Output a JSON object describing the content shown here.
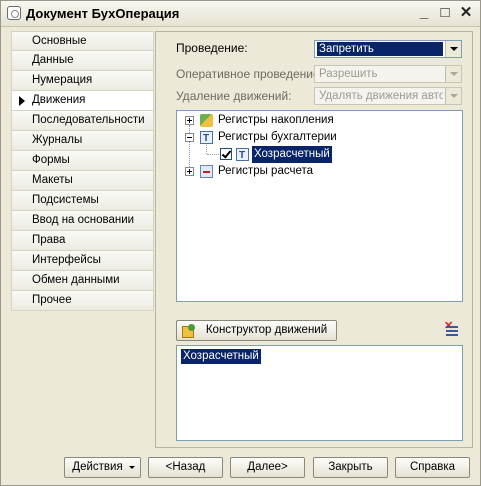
{
  "window": {
    "title": "Документ БухОперация",
    "controls": {
      "minimize": "_",
      "maximize": "□",
      "close": "✕"
    }
  },
  "nav": {
    "items": [
      {
        "label": "Основные",
        "active": false
      },
      {
        "label": "Данные",
        "active": false
      },
      {
        "label": "Нумерация",
        "active": false
      },
      {
        "label": "Движения",
        "active": true
      },
      {
        "label": "Последовательности",
        "active": false
      },
      {
        "label": "Журналы",
        "active": false
      },
      {
        "label": "Формы",
        "active": false
      },
      {
        "label": "Макеты",
        "active": false
      },
      {
        "label": "Подсистемы",
        "active": false
      },
      {
        "label": "Ввод на основании",
        "active": false
      },
      {
        "label": "Права",
        "active": false
      },
      {
        "label": "Интерфейсы",
        "active": false
      },
      {
        "label": "Обмен данными",
        "active": false
      },
      {
        "label": "Прочее",
        "active": false
      }
    ]
  },
  "properties": {
    "posting": {
      "label": "Проведение:",
      "value": "Запретить"
    },
    "realtime_posting": {
      "label": "Оперативное проведение:",
      "value": "Разрешить"
    },
    "delete_movements": {
      "label": "Удаление движений:",
      "value": "Удалять движения автом"
    }
  },
  "tree": {
    "nodes": [
      {
        "label": "Регистры накопления",
        "icon": "accumulation-register-icon"
      },
      {
        "label": "Регистры бухгалтерии",
        "icon": "accounting-register-icon"
      },
      {
        "label": "Хозрасчетный",
        "icon": "accounting-register-icon",
        "checked": true,
        "selected": true
      },
      {
        "label": "Регистры расчета",
        "icon": "calculation-register-icon"
      }
    ]
  },
  "constructor_button": {
    "label": "Конструктор движений",
    "icon": "constructor-icon"
  },
  "movement_list": {
    "items": [
      "Хозрасчетный"
    ]
  },
  "buttons": {
    "actions": "Действия",
    "back": "<Назад",
    "next": "Далее>",
    "close": "Закрыть",
    "help": "Справка"
  }
}
